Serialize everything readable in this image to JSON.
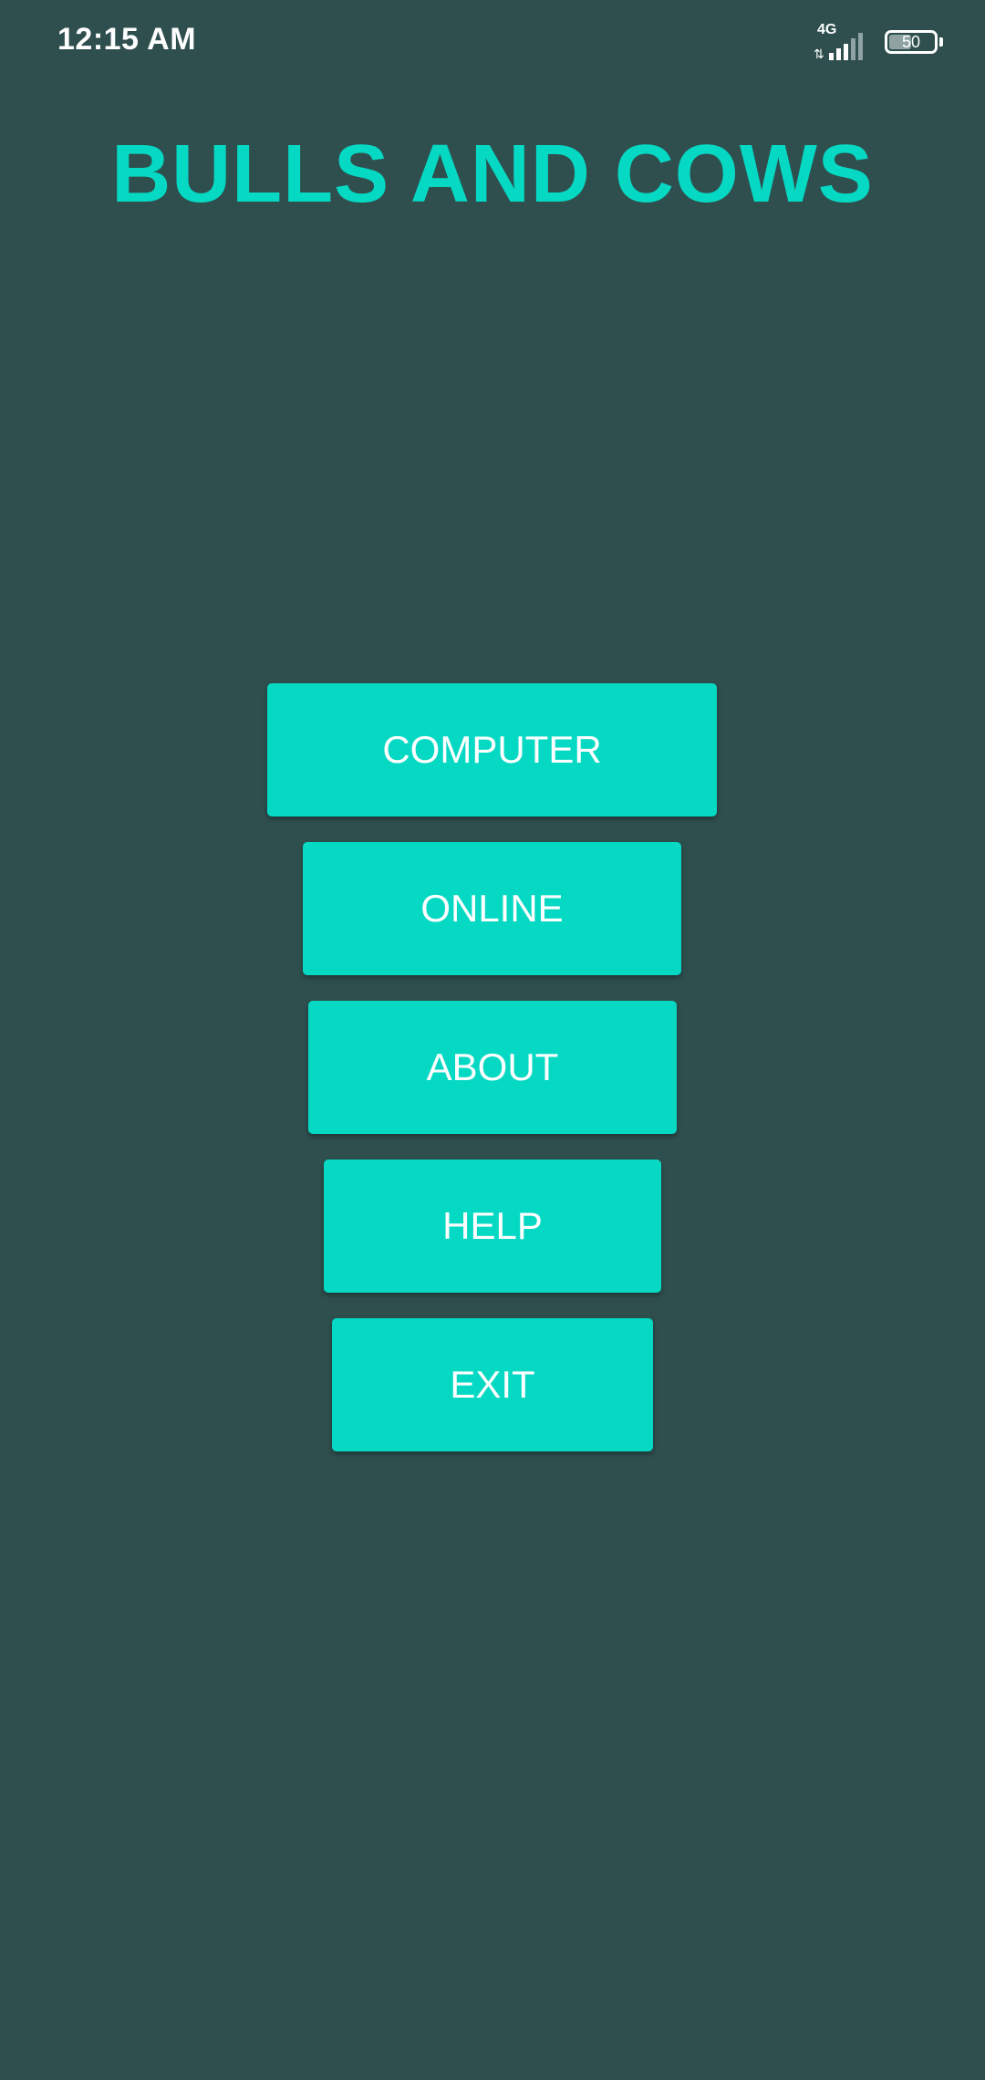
{
  "status_bar": {
    "time": "12:15 AM",
    "network_type": "4G",
    "data_arrows": "⇅",
    "signal_icon": "signal-bars-icon",
    "signal_level": 0.6,
    "battery_level": "50",
    "battery_fraction": 0.5
  },
  "app": {
    "title": "BULLS AND COWS"
  },
  "menu": {
    "computer_label": "COMPUTER",
    "online_label": "ONLINE",
    "about_label": "ABOUT",
    "help_label": "HELP",
    "exit_label": "EXIT"
  },
  "colors": {
    "background": "#2f4f4f",
    "accent": "#05d9c3",
    "button_text": "#ffffff"
  }
}
